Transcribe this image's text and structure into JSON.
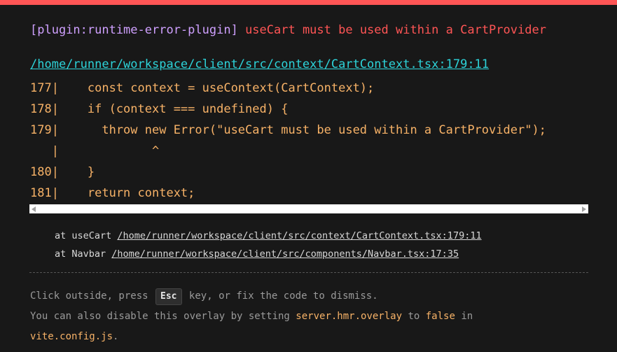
{
  "overlay": {
    "plugin": "[plugin:runtime-error-plugin]",
    "message": "useCart must be used within a CartProvider",
    "file": "/home/runner/workspace/client/src/context/CartContext.tsx:179:11",
    "code_lines": [
      "177|    const context = useContext(CartContext);",
      "178|    if (context === undefined) {",
      "179|      throw new Error(\"useCart must be used within a CartProvider\");",
      "   |             ^",
      "180|    }",
      "181|    return context;"
    ],
    "stack": [
      {
        "prefix": "at useCart ",
        "link": "/home/runner/workspace/client/src/context/CartContext.tsx:179:11"
      },
      {
        "prefix": "at Navbar ",
        "link": "/home/runner/workspace/client/src/components/Navbar.tsx:17:35"
      }
    ],
    "tip": {
      "line1_before": "Click outside, press ",
      "key": "Esc",
      "line1_after": " key, or fix the code to dismiss.",
      "line2_before": "You can also disable this overlay by setting ",
      "setting": "server.hmr.overlay",
      "line2_mid": " to ",
      "value": "false",
      "line2_after": " in",
      "config": "vite.config.js",
      "end": "."
    }
  },
  "colors": {
    "accent_error": "#ff5555",
    "plugin": "#cfa0ff",
    "file_link": "#2dd4da",
    "code": "#f7b267",
    "background": "#181818"
  }
}
